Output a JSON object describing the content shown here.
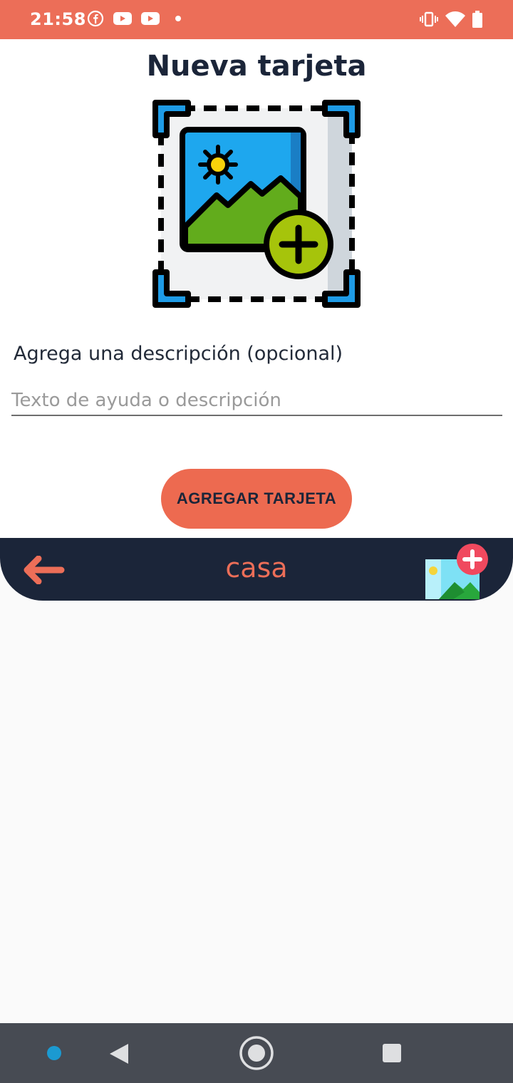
{
  "status_bar": {
    "time": "21:58",
    "notification_icons": [
      "facebook-icon",
      "youtube-icon",
      "youtube-icon",
      "dot-icon"
    ],
    "system_icons": [
      "vibrate-icon",
      "wifi-icon",
      "battery-icon"
    ]
  },
  "page": {
    "title": "Nueva tarjeta",
    "hero_icon": "add-image-icon"
  },
  "form": {
    "description_label": "Agrega una descripción (opcional)",
    "description_placeholder": "Texto de ayuda o descripción",
    "description_value": "",
    "submit_label": "AGREGAR TARJETA"
  },
  "app_bar": {
    "title": "casa",
    "back_icon": "arrow-left-icon",
    "action_icon": "add-picture-icon"
  },
  "nav_bar": {
    "buttons": [
      "back-icon",
      "home-icon",
      "recents-icon"
    ]
  },
  "colors": {
    "accent": "#ec6e58",
    "dark": "#1b2539",
    "button": "#ed6a50"
  }
}
